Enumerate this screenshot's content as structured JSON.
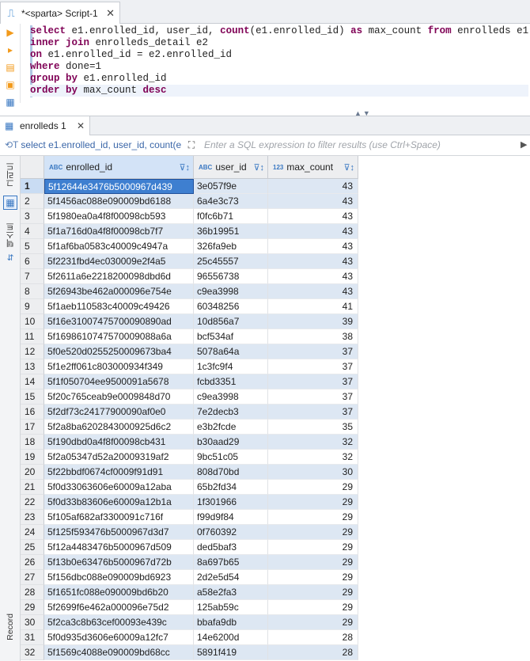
{
  "editor_tab": {
    "title": "*<sparta> Script-1",
    "close": "✕"
  },
  "sql_lines": [
    [
      {
        "t": "select",
        "k": 1
      },
      {
        "t": " e1.enrolled_id, user_id, ",
        "k": 0
      },
      {
        "t": "count",
        "k": 1
      },
      {
        "t": "(e1.enrolled_id) ",
        "k": 0
      },
      {
        "t": "as",
        "k": 1
      },
      {
        "t": " max_count ",
        "k": 0
      },
      {
        "t": "from",
        "k": 1
      },
      {
        "t": " enrolleds e1",
        "k": 0
      }
    ],
    [
      {
        "t": "inner join",
        "k": 1
      },
      {
        "t": " enrolleds_detail e2",
        "k": 0
      }
    ],
    [
      {
        "t": "on",
        "k": 1
      },
      {
        "t": " e1.enrolled_id = e2.enrolled_id",
        "k": 0
      }
    ],
    [
      {
        "t": "where",
        "k": 1
      },
      {
        "t": " done=1",
        "k": 0
      }
    ],
    [
      {
        "t": "group by",
        "k": 1
      },
      {
        "t": " e1.enrolled_id",
        "k": 0
      }
    ],
    [
      {
        "t": "order by",
        "k": 1
      },
      {
        "t": " max_count ",
        "k": 0
      },
      {
        "t": "desc",
        "k": 1
      }
    ]
  ],
  "results_tab": {
    "title": "enrolleds 1",
    "close": "✕"
  },
  "filter": {
    "query_text": "select e1.enrolled_id, user_id, count(e",
    "placeholder": "Enter a SQL expression to filter results (use Ctrl+Space)"
  },
  "side_panel": {
    "grid_label": "그리드",
    "text_label": "텍스트",
    "record_label": "Record"
  },
  "columns": [
    {
      "type": "ABC",
      "name": "enrolled_id"
    },
    {
      "type": "ABC",
      "name": "user_id"
    },
    {
      "type": "123",
      "name": "max_count"
    }
  ],
  "rows": [
    [
      "1",
      "5f12644e3476b5000967d439",
      "3e057f9e",
      "43"
    ],
    [
      "2",
      "5f1456ac088e090009bd6188",
      "6a4e3c73",
      "43"
    ],
    [
      "3",
      "5f1980ea0a4f8f00098cb593",
      "f0fc6b71",
      "43"
    ],
    [
      "4",
      "5f1a716d0a4f8f00098cb7f7",
      "36b19951",
      "43"
    ],
    [
      "5",
      "5f1af6ba0583c40009c4947a",
      "326fa9eb",
      "43"
    ],
    [
      "6",
      "5f2231fbd4ec030009e2f4a5",
      "25c45557",
      "43"
    ],
    [
      "7",
      "5f2611a6e2218200098dbd6d",
      "96556738",
      "43"
    ],
    [
      "8",
      "5f26943be462a000096e754e",
      "c9ea3998",
      "43"
    ],
    [
      "9",
      "5f1aeb110583c40009c49426",
      "60348256",
      "41"
    ],
    [
      "10",
      "5f16e3100747570009089 0ad",
      "10d856a7",
      "39"
    ],
    [
      "11",
      "5f169861074757000908 8a6a",
      "bcf534af",
      "38"
    ],
    [
      "12",
      "5f0e520d0255250009673ba4",
      "5078a64a",
      "37"
    ],
    [
      "13",
      "5f1e2ff061c803000934f349",
      "1c3fc9f4",
      "37"
    ],
    [
      "14",
      "5f1f050704ee9500091a5678",
      "fcbd3351",
      "37"
    ],
    [
      "15",
      "5f20c765ceab9e0009848d70",
      "c9ea3998",
      "37"
    ],
    [
      "16",
      "5f2df73c24177900090af0e0",
      "7e2decb3",
      "37"
    ],
    [
      "17",
      "5f2a8ba6202843000925d6c2",
      "e3b2fcde",
      "35"
    ],
    [
      "18",
      "5f190dbd0a4f8f00098cb431",
      "b30aad29",
      "32"
    ],
    [
      "19",
      "5f2a05347d52a20009319af2",
      "9bc51c05",
      "32"
    ],
    [
      "20",
      "5f22bbdf0674cf0009f91d91",
      "808d70bd",
      "30"
    ],
    [
      "21",
      "5f0d33063606e60009a12aba",
      "65b2fd34",
      "29"
    ],
    [
      "22",
      "5f0d33b83606e60009a12b1a",
      "1f301966",
      "29"
    ],
    [
      "23",
      "5f105af682af3300091c716f",
      "f99d9f84",
      "29"
    ],
    [
      "24",
      "5f125f593476b5000967d3d7",
      "0f760392",
      "29"
    ],
    [
      "25",
      "5f12a4483476b5000967d509",
      "ded5baf3",
      "29"
    ],
    [
      "26",
      "5f13b0e63476b5000967d72b",
      "8a697b65",
      "29"
    ],
    [
      "27",
      "5f156dbc088e090009bd6923",
      "2d2e5d54",
      "29"
    ],
    [
      "28",
      "5f1651fc088e090009bd6b20",
      "a58e2fa3",
      "29"
    ],
    [
      "29",
      "5f2699f6e462a000096e75d2",
      "125ab59c",
      "29"
    ],
    [
      "30",
      "5f2ca3c8b63cef00093e439c",
      "bbafa9db",
      "29"
    ],
    [
      "31",
      "5f0d935d3606e60009a12fc7",
      "14e6200d",
      "28"
    ],
    [
      "32",
      "5f1569c4088e090009bd68cc",
      "5891f419",
      "28"
    ]
  ]
}
